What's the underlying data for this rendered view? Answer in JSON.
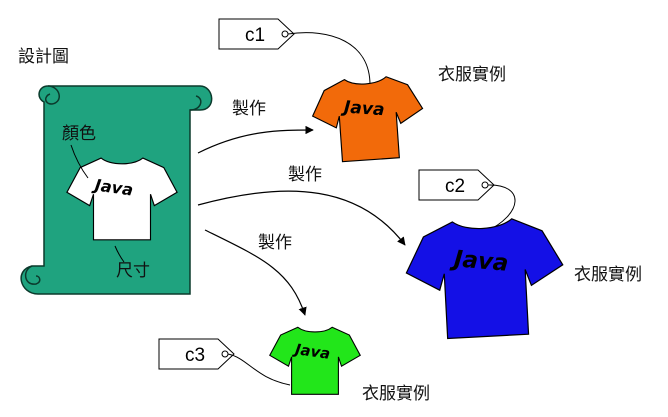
{
  "blueprint": {
    "title": "設計圖",
    "color_label": "顏色",
    "size_label": "尺寸",
    "shirt_text": "Java",
    "fill": "#1fa37f"
  },
  "arrows": [
    {
      "label": "製作"
    },
    {
      "label": "製作"
    },
    {
      "label": "製作"
    }
  ],
  "instances": [
    {
      "tag": "c1",
      "label": "衣服實例",
      "shirt_text": "Java",
      "color": "#f26a0a"
    },
    {
      "tag": "c2",
      "label": "衣服實例",
      "shirt_text": "Java",
      "color": "#1410e6"
    },
    {
      "tag": "c3",
      "label": "衣服實例",
      "shirt_text": "Java",
      "color": "#22e61a"
    }
  ]
}
